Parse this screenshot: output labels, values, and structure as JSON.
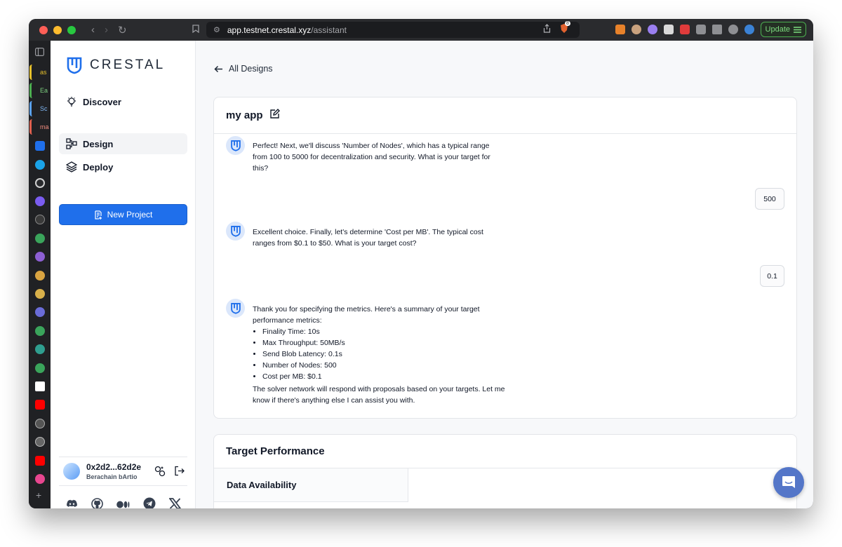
{
  "browser": {
    "url_host": "app.testnet.crestal.xyz",
    "url_path": "/assistant",
    "update_label": "Update",
    "shield_count": "8"
  },
  "tabs": [
    {
      "label": "as",
      "color": "#e6c02b"
    },
    {
      "label": "Ea",
      "color": "#4caf50"
    },
    {
      "label": "Sc",
      "color": "#5aa2f0"
    },
    {
      "label": "ma",
      "color": "#e0604e"
    }
  ],
  "sidebar": {
    "logo_text": "CRESTAL",
    "nav": [
      {
        "label": "Discover",
        "icon": "lightbulb-icon"
      },
      {
        "label": "Design",
        "icon": "design-nodes-icon"
      },
      {
        "label": "Deploy",
        "icon": "layers-icon"
      }
    ],
    "new_project_label": "New Project",
    "wallet": {
      "address": "0x2d2...62d2e",
      "network": "Berachain bArtio"
    }
  },
  "main": {
    "back_label": "All Designs",
    "chat_title": "my app",
    "messages": [
      {
        "text": "Perfect! Next, we'll discuss 'Number of Nodes', which has a typical range from 100 to 5000 for decentralization and security. What is your target for this?"
      },
      {
        "user": "500"
      },
      {
        "text": "Excellent choice. Finally, let's determine 'Cost per MB'. The typical cost ranges from $0.1 to $50. What is your target cost?"
      },
      {
        "user": "0.1"
      },
      {
        "intro": "Thank you for specifying the metrics. Here's a summary of your target performance metrics:",
        "bullets": [
          "Finality Time: 10s",
          "Max Throughput: 50MB/s",
          "Send Blob Latency: 0.1s",
          "Number of Nodes: 500",
          "Cost per MB: $0.1"
        ],
        "outro": "The solver network will respond with proposals based on your targets. Let me know if there's anything else I can assist you with."
      }
    ],
    "target_title": "Target Performance",
    "target_tab": "Data Availability"
  },
  "colors": {
    "accent": "#1f6feb",
    "fab": "#5476c8"
  }
}
